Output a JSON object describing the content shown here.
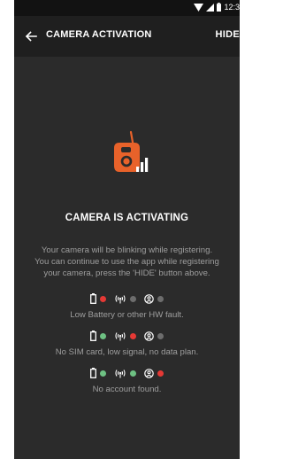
{
  "status_bar": {
    "time": "12:3"
  },
  "app_bar": {
    "title": "CAMERA ACTIVATION",
    "action": "HIDE"
  },
  "main": {
    "heading": "CAMERA IS ACTIVATING",
    "description_lines": [
      "Your camera will be blinking while registering.",
      "You can continue to use the app while registering",
      "your camera, press the 'HIDE' button above."
    ]
  },
  "legend": [
    {
      "battery": "red",
      "signal": "grey",
      "account": "grey",
      "text": "Low Battery or other HW fault."
    },
    {
      "battery": "green",
      "signal": "red",
      "account": "grey",
      "text": "No SIM card, low signal, no data plan."
    },
    {
      "battery": "green",
      "signal": "green",
      "account": "red",
      "text": "No account found."
    }
  ],
  "colors": {
    "accent": "#e8622a",
    "red": "#e53935",
    "green": "#6ec183",
    "grey": "#6d6d6d",
    "background": "#2b2b2b"
  },
  "icons": [
    "wifi-icon",
    "cell-signal-icon",
    "battery-icon",
    "back-arrow-icon",
    "camera-activating-icon",
    "battery-icon",
    "signal-icon",
    "account-icon"
  ]
}
